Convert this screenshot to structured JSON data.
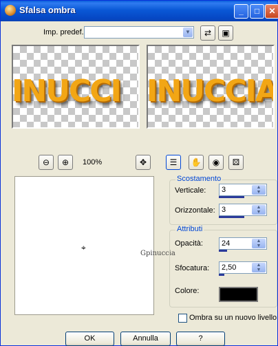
{
  "window": {
    "title": "Sfalsa ombra",
    "controls": {
      "minimize": "_",
      "maximize": "□",
      "close": "✕"
    }
  },
  "preset": {
    "label": "Imp. predef.:",
    "value": ""
  },
  "preview": {
    "text_left": "INUCCI",
    "text_right": "INUCCIA"
  },
  "zoom": {
    "level": "100%"
  },
  "offset": {
    "title": "Scostamento",
    "vertical_label": "Verticale:",
    "vertical_value": "3",
    "horizontal_label": "Orizzontale:",
    "horizontal_value": "3"
  },
  "attributes": {
    "title": "Attributi",
    "opacity_label": "Opacità:",
    "opacity_value": "24",
    "blur_label": "Sfocatura:",
    "blur_value": "2,50",
    "color_label": "Colore:",
    "color": "#000000"
  },
  "new_layer": {
    "label": "Ombra su un nuovo livello",
    "checked": false
  },
  "buttons": {
    "ok": "OK",
    "cancel": "Annulla",
    "help": "?"
  },
  "watermark": "Gpinuccia"
}
